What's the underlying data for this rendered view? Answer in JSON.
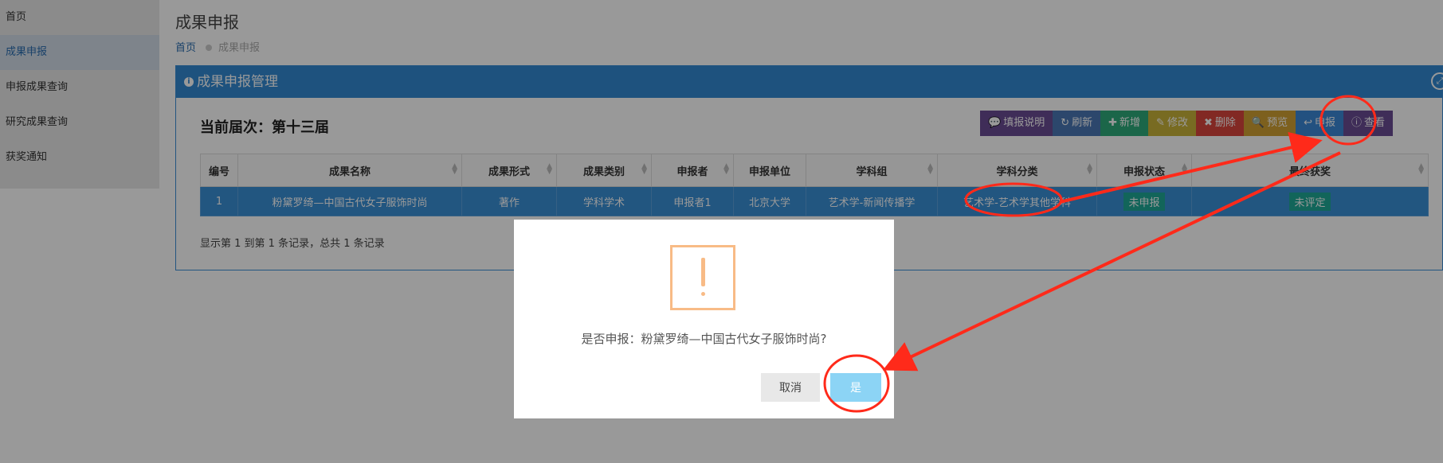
{
  "sidebar": {
    "items": [
      {
        "label": "首页"
      },
      {
        "label": "成果申报"
      },
      {
        "label": "申报成果查询"
      },
      {
        "label": "研究成果查询"
      },
      {
        "label": "获奖通知"
      }
    ]
  },
  "header": {
    "title": "成果申报",
    "breadcrumb": [
      "首页",
      "成果申报"
    ]
  },
  "panel": {
    "title": "成果申报管理",
    "session": "当前届次：第十三届"
  },
  "toolbar": {
    "buttons": [
      {
        "label": "填报说明",
        "icon": "comment-icon",
        "color": "#6a4c93"
      },
      {
        "label": "刷新",
        "icon": "refresh-icon",
        "color": "#4a77b4"
      },
      {
        "label": "新增",
        "icon": "plus-icon",
        "color": "#2eab7a"
      },
      {
        "label": "修改",
        "icon": "edit-icon",
        "color": "#c9b33a"
      },
      {
        "label": "删除",
        "icon": "times-icon",
        "color": "#d9453c"
      },
      {
        "label": "预览",
        "icon": "search-icon",
        "color": "#d0a032"
      },
      {
        "label": "申报",
        "icon": "reply-icon",
        "color": "#3b87d6"
      },
      {
        "label": "查看",
        "icon": "info-icon",
        "color": "#6a4c93"
      }
    ]
  },
  "table": {
    "columns": [
      "编号",
      "成果名称",
      "成果形式",
      "成果类别",
      "申报者",
      "申报单位",
      "学科组",
      "学科分类",
      "申报状态",
      "最终获奖"
    ],
    "rows": [
      [
        "1",
        "粉黛罗绮—中国古代女子服饰时尚",
        "著作",
        "学科学术",
        "申报者1",
        "北京大学",
        "艺术学-新闻传播学",
        "艺术学-艺术学其他学科",
        "未申报",
        "未评定"
      ]
    ]
  },
  "records": "显示第 1 到第 1 条记录，总共 1 条记录",
  "dialog": {
    "message": "是否申报：粉黛罗绮—中国古代女子服饰时尚?",
    "cancel_label": "取消",
    "confirm_label": "是"
  },
  "colors": {
    "accent": "#3289d3",
    "annotation": "#ff2a1a",
    "warning": "#f8bb86",
    "confirm": "#8cd4f5"
  }
}
